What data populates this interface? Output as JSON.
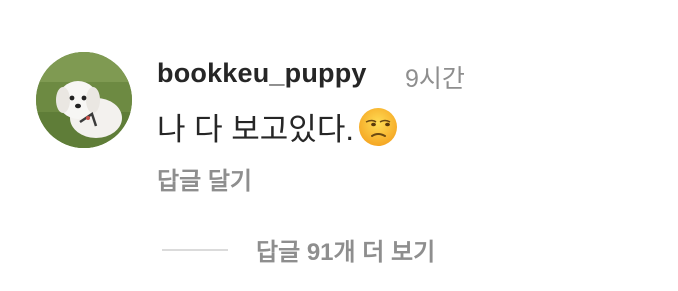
{
  "comment": {
    "avatar_icon": "puppy-avatar",
    "username": "bookkeu_puppy",
    "timestamp": "9시간",
    "text": "나 다 보고있다.",
    "emoji_icon": "unamused-face-emoji",
    "reply_label": "답글 달기"
  },
  "replies": {
    "view_label": "답글 91개 더 보기"
  },
  "colors": {
    "primary_text": "#262626",
    "secondary_text": "#8e8e8e",
    "divider": "#dbdbdb"
  }
}
